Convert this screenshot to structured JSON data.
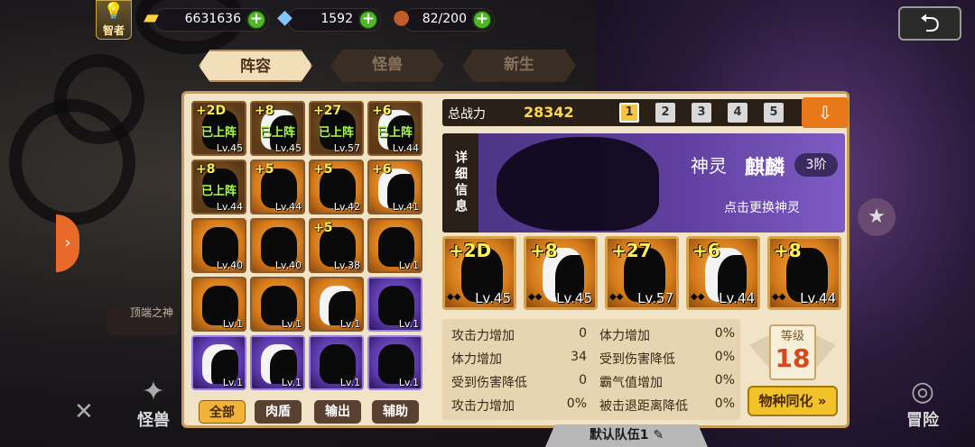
{
  "topbar": {
    "badge_label": "智者",
    "gold": "6631636",
    "gems": "1592",
    "stamina": "82/200"
  },
  "tabs": [
    "阵容",
    "怪兽",
    "新生"
  ],
  "grid": [
    {
      "star": "+2D",
      "level": "Lv.45",
      "on": "已上阵",
      "style": "dim",
      "white": false
    },
    {
      "star": "+8",
      "level": "Lv.45",
      "on": "已上阵",
      "style": "dim",
      "white": true
    },
    {
      "star": "+27",
      "level": "Lv.57",
      "on": "已上阵",
      "style": "dim",
      "white": false
    },
    {
      "star": "+6",
      "level": "Lv.44",
      "on": "已上阵",
      "style": "dim",
      "white": true
    },
    {
      "star": "+8",
      "level": "Lv.44",
      "on": "已上阵",
      "style": "dim",
      "white": false
    },
    {
      "star": "+5",
      "level": "Lv.44",
      "on": "",
      "style": "orange",
      "white": false
    },
    {
      "star": "+5",
      "level": "Lv.42",
      "on": "",
      "style": "orange",
      "white": false
    },
    {
      "star": "+6",
      "level": "Lv.41",
      "on": "",
      "style": "orange",
      "white": true
    },
    {
      "star": "",
      "level": "Lv.40",
      "on": "",
      "style": "orange",
      "white": false
    },
    {
      "star": "",
      "level": "Lv.40",
      "on": "",
      "style": "orange",
      "white": false
    },
    {
      "star": "+5",
      "level": "Lv.38",
      "on": "",
      "style": "orange",
      "white": false
    },
    {
      "star": "",
      "level": "Lv.1",
      "on": "",
      "style": "orange",
      "white": false
    },
    {
      "star": "",
      "level": "Lv.1",
      "on": "",
      "style": "orange",
      "white": false
    },
    {
      "star": "",
      "level": "Lv.1",
      "on": "",
      "style": "orange",
      "white": false
    },
    {
      "star": "",
      "level": "Lv.1",
      "on": "",
      "style": "orange",
      "white": true
    },
    {
      "star": "",
      "level": "Lv.1",
      "on": "",
      "style": "purple",
      "white": false
    },
    {
      "star": "",
      "level": "Lv.1",
      "on": "",
      "style": "purple",
      "white": true
    },
    {
      "star": "",
      "level": "Lv.1",
      "on": "",
      "style": "purple",
      "white": true
    },
    {
      "star": "",
      "level": "Lv.1",
      "on": "",
      "style": "purple",
      "white": false
    },
    {
      "star": "",
      "level": "Lv.1",
      "on": "",
      "style": "purple",
      "white": false
    }
  ],
  "filters": [
    "全部",
    "肉盾",
    "输出",
    "辅助"
  ],
  "power": {
    "label": "总战力",
    "value": "28342",
    "slots": [
      "1",
      "2",
      "3",
      "4",
      "5"
    ]
  },
  "banner": {
    "detail": "详细信息",
    "god_type": "神灵",
    "god_name": "麒麟",
    "rank": "3阶",
    "tap": "点击更换神灵"
  },
  "team": [
    {
      "star": "+2D",
      "level": "Lv.45",
      "white": false
    },
    {
      "star": "+8",
      "level": "Lv.45",
      "white": true
    },
    {
      "star": "+27",
      "level": "Lv.57",
      "white": false
    },
    {
      "star": "+6",
      "level": "Lv.44",
      "white": true
    },
    {
      "star": "+8",
      "level": "Lv.44",
      "white": false
    }
  ],
  "stats": [
    {
      "label": "攻击力增加",
      "value": "0"
    },
    {
      "label": "体力增加",
      "value": "0%"
    },
    {
      "label": "体力增加",
      "value": "34"
    },
    {
      "label": "受到伤害降低",
      "value": "0%"
    },
    {
      "label": "受到伤害降低",
      "value": "0"
    },
    {
      "label": "霸气值增加",
      "value": "0%"
    },
    {
      "label": "攻击力增加",
      "value": "0%"
    },
    {
      "label": "被击退距离降低",
      "value": "0%"
    }
  ],
  "level": {
    "label": "等级",
    "value": "18"
  },
  "sync_label": "物种同化",
  "team_name": "默认队伍1",
  "bottom_nav": [
    "怪兽",
    "冒险"
  ],
  "side_label": "顶端之神"
}
